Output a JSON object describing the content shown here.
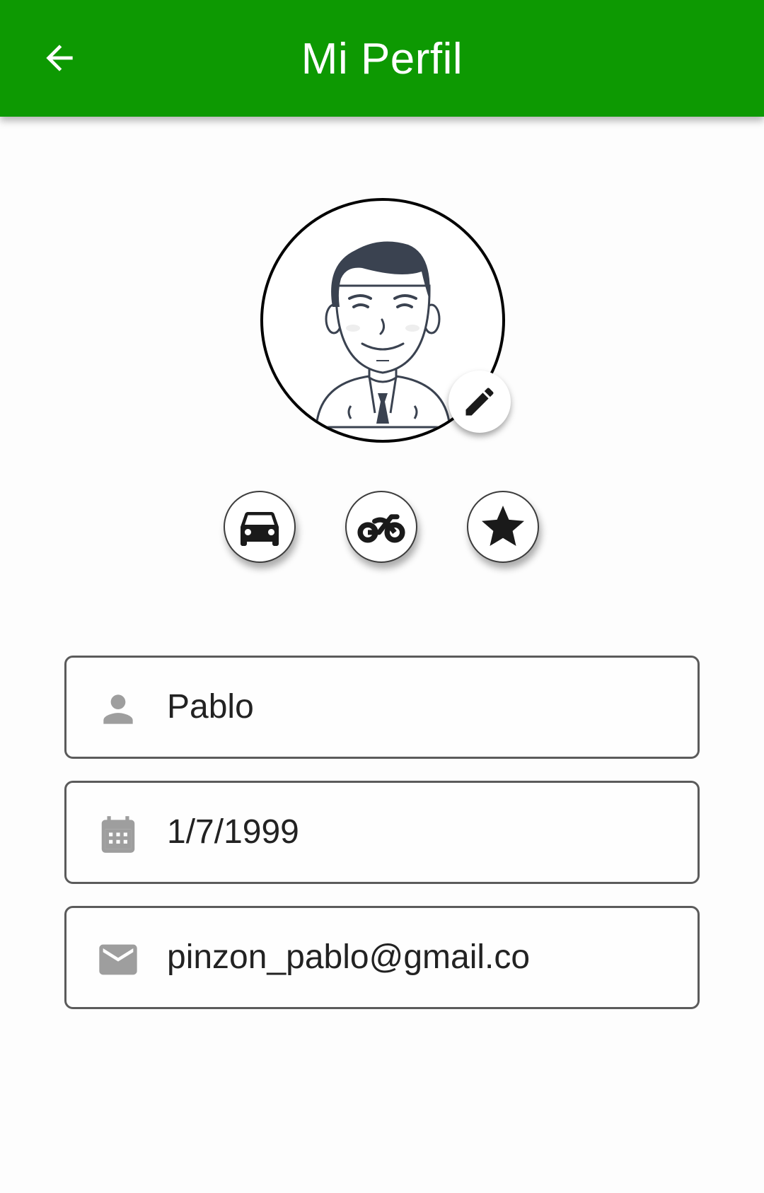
{
  "header": {
    "title": "Mi Perfil",
    "back_icon": "arrow-left-icon"
  },
  "avatar": {
    "icon": "man-with-tie-avatar",
    "edit_icon": "pencil-icon"
  },
  "categories": [
    {
      "icon": "car-icon"
    },
    {
      "icon": "motorcycle-icon"
    },
    {
      "icon": "star-icon"
    }
  ],
  "form": {
    "name": {
      "icon": "person-icon",
      "value": "Pablo"
    },
    "birthdate": {
      "icon": "calendar-icon",
      "value": "1/7/1999"
    },
    "email": {
      "icon": "mail-icon",
      "value": "pinzon_pablo@gmail.co"
    }
  },
  "colors": {
    "primary": "#0d9902",
    "field_border": "#5b5b5b",
    "icon_gray": "#9e9e9e"
  }
}
